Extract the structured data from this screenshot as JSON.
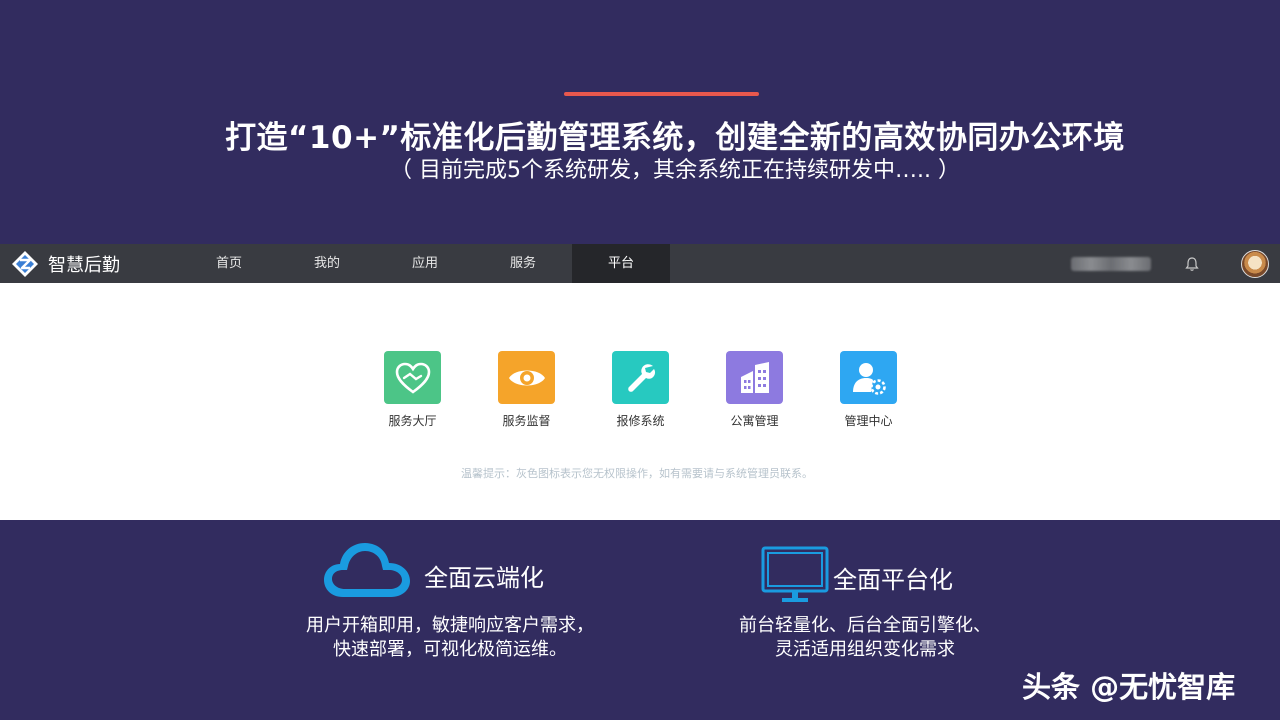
{
  "slide": {
    "headline": "打造“10+”标准化后勤管理系统，创建全新的高效协同办公环境",
    "subheadline": "（ 目前完成5个系统研发，其余系统正在持续研发中….. ）",
    "accent_color": "#e8584d",
    "background_color": "#322c5f"
  },
  "app": {
    "brand_name": "智慧后勤",
    "nav_tabs": [
      {
        "label": "首页",
        "active": false
      },
      {
        "label": "我的",
        "active": false
      },
      {
        "label": "应用",
        "active": false
      },
      {
        "label": "服务",
        "active": false
      },
      {
        "label": "平台",
        "active": true
      }
    ],
    "icons": {
      "bell": "bell-icon",
      "avatar": "user-avatar"
    },
    "tiles": [
      {
        "label": "服务大厅",
        "icon": "handshake-heart-icon",
        "color": "#4cc587"
      },
      {
        "label": "服务监督",
        "icon": "eye-icon",
        "color": "#f5a42a"
      },
      {
        "label": "报修系统",
        "icon": "wrench-icon",
        "color": "#27c9c0"
      },
      {
        "label": "公寓管理",
        "icon": "building-icon",
        "color": "#8d7ae0"
      },
      {
        "label": "管理中心",
        "icon": "user-gear-icon",
        "color": "#2ea7f2"
      }
    ],
    "hint": "温馨提示：灰色图标表示您无权限操作，如有需要请与系统管理员联系。"
  },
  "features": [
    {
      "title": "全面云端化",
      "icon": "cloud-icon",
      "desc_line1": "用户开箱即用，敏捷响应客户需求，",
      "desc_line2": "快速部署，可视化极简运维。"
    },
    {
      "title": "全面平台化",
      "icon": "monitor-icon",
      "desc_line1": "前台轻量化、后台全面引擎化、",
      "desc_line2": "灵活适用组织变化需求"
    }
  ],
  "watermark": "头条 @无忧智库"
}
